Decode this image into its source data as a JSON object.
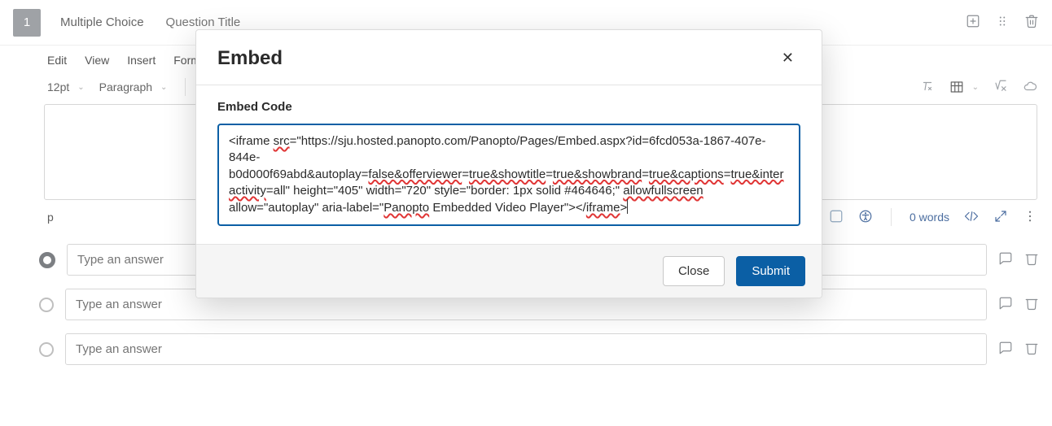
{
  "question": {
    "number": "1",
    "type": "Multiple Choice",
    "title_placeholder": "Question Title"
  },
  "editor": {
    "menu": {
      "edit": "Edit",
      "view": "View",
      "insert": "Insert",
      "format": "Format"
    },
    "font_size": "12pt",
    "block_style": "Paragraph",
    "path": "p",
    "word_count": "0 words"
  },
  "answers": [
    {
      "placeholder": "Type an answer"
    },
    {
      "placeholder": "Type an answer"
    },
    {
      "placeholder": "Type an answer"
    }
  ],
  "modal": {
    "title": "Embed",
    "label": "Embed Code",
    "code_parts": {
      "p0": "<iframe ",
      "p1": "src",
      "p2": "=\"https://sju.hosted.panopto.com/Panopto/Pages/Embed.aspx?id=6fcd053a-1867-407e-844e-b0d000f69abd&autoplay=",
      "p3": "false&offerviewer",
      "p4": "=",
      "p5": "true&showtitle",
      "p6": "=",
      "p7": "true&showbrand",
      "p8": "=",
      "p9": "true&captions",
      "p10": "=",
      "p11": "true&interactivity",
      "p12": "=all\" height=\"405\" width=\"720\" style=\"border: 1px solid #464646;\" ",
      "p13": "allowfullscreen",
      "p14": " allow=\"autoplay\" aria-label=\"",
      "p15": "Panopto",
      "p16": " Embedded Video Player\"></",
      "p17": "iframe",
      "p18": ">"
    },
    "close_label": "Close",
    "submit_label": "Submit"
  }
}
